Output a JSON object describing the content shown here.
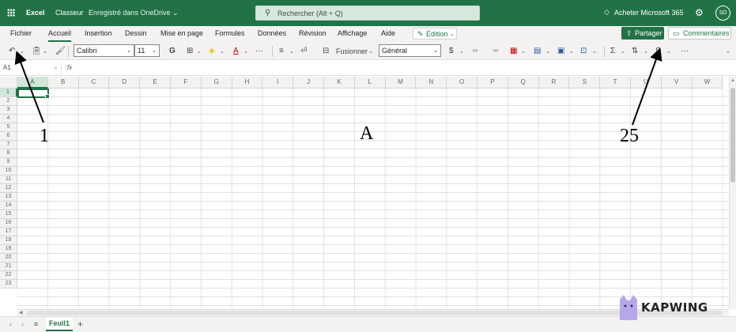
{
  "topbar": {
    "app_name": "Excel",
    "doc_name": "Classeur",
    "save_status": "Enregistré dans OneDrive ⌄",
    "search_placeholder": "Rechercher (Alt + Q)",
    "buy_label": "Acheter Microsoft 365",
    "avatar_initials": "SD",
    "color": "#217346"
  },
  "menu": {
    "items": [
      "Fichier",
      "Accueil",
      "Insertion",
      "Dessin",
      "Mise en page",
      "Formules",
      "Données",
      "Révision",
      "Affichage",
      "Aide"
    ],
    "active": "Accueil",
    "edit_label": "Édition",
    "share_label": "Partager",
    "comments_label": "Commentaires"
  },
  "toolbar": {
    "font_name": "Calibri",
    "font_size": "11",
    "bold_label": "G",
    "merge_label": "Fusionner",
    "number_format": "Général",
    "more_label": "···"
  },
  "formula_bar": {
    "cell_ref": "A1",
    "fx_label": "fx",
    "value": ""
  },
  "grid": {
    "columns": [
      "A",
      "B",
      "C",
      "D",
      "E",
      "F",
      "G",
      "H",
      "I",
      "J",
      "K",
      "L",
      "M",
      "N",
      "O",
      "P",
      "Q",
      "R",
      "S",
      "T",
      "U",
      "V",
      "W"
    ],
    "rows": [
      "1",
      "2",
      "3",
      "4",
      "5",
      "6",
      "7",
      "8",
      "9",
      "10",
      "11",
      "12",
      "13",
      "14",
      "15",
      "16",
      "17",
      "18",
      "19",
      "20",
      "21",
      "22",
      "23"
    ],
    "selected_cell": "A1"
  },
  "sheets": {
    "tabs": [
      "Feuil1"
    ],
    "active": "Feuil1"
  },
  "annotations": {
    "label_left": "1",
    "label_center": "A",
    "label_right": "25"
  },
  "watermark": {
    "text": "KAPWING"
  }
}
